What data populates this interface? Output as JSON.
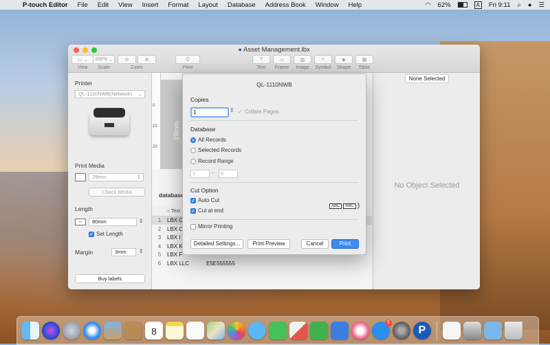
{
  "menubar": {
    "items": [
      "P-touch Editor",
      "File",
      "Edit",
      "View",
      "Insert",
      "Format",
      "Layout",
      "Database",
      "Address Book",
      "Window",
      "Help"
    ],
    "battery": "62%",
    "clock": "Fri 9:11",
    "input_source": "A"
  },
  "window": {
    "title": "Asset Management.lbx",
    "toolbar": {
      "view_label": "View",
      "scale_label": "Scale",
      "scale_value": "200%",
      "zoom_label": "Zoom",
      "print_label": "Print",
      "text_label": "Text",
      "frame_label": "Frame",
      "image_label": "Image",
      "symbol_label": "Symbol",
      "shape_label": "Shape",
      "table_label": "Table"
    },
    "left_panel": {
      "printer_heading": "Printer",
      "printer_select": "QL-1110NWB(Network)",
      "print_media_heading": "Print Media",
      "media_select": "29mm",
      "check_media_button": "Check Media",
      "length_heading": "Length",
      "length_value": "80mm",
      "set_length_label": "Set Length",
      "margin_heading": "Margin",
      "margin_value": "3mm",
      "buy_labels_button": "Buy labels"
    },
    "canvas": {
      "tape_label": "29mm",
      "ruler_marks": [
        "0",
        "10",
        "20"
      ],
      "database_label": "database",
      "column_header": "Text",
      "rows": [
        {
          "num": "1",
          "c1": "LBX C",
          "c2": ""
        },
        {
          "num": "2",
          "c1": "LBX C",
          "c2": ""
        },
        {
          "num": "3",
          "c1": "LBX I",
          "c2": ""
        },
        {
          "num": "4",
          "c1": "LBX K",
          "c2": ""
        },
        {
          "num": "5",
          "c1": "LBX F",
          "c2": ""
        },
        {
          "num": "6",
          "c1": "LBX LLC",
          "c2": "E5E555555"
        }
      ]
    },
    "right_panel": {
      "none_selected": "None Selected",
      "no_object": "No Object Selected"
    }
  },
  "dialog": {
    "title": "QL-1110NWB",
    "copies_heading": "Copies",
    "copies_value": "1",
    "collate_label": "Collate Pages",
    "database_heading": "Database",
    "all_records": "All Records",
    "selected_records": "Selected Records",
    "record_range": "Record Range",
    "range_from": "1",
    "range_dash": "-",
    "range_to": "6",
    "cut_option_heading": "Cut Option",
    "auto_cut": "Auto Cut",
    "cut_at_end": "Cut at end",
    "cut_preview_a": "ABC",
    "cut_preview_b": "ABC",
    "mirror_printing": "Mirror Printing",
    "detailed_settings_button": "Detailed Settings...",
    "print_preview_button": "Print Preview",
    "cancel_button": "Cancel",
    "print_button": "Print"
  },
  "dock": {
    "apps": [
      "finder-icon",
      "siri-icon",
      "launchpad-icon",
      "safari-icon",
      "photo-icon",
      "contacts-icon",
      "calendar-icon",
      "notes-icon",
      "reminders-icon",
      "maps-icon",
      "photos-icon",
      "messages-icon",
      "facetime-icon",
      "news-icon",
      "numbers-icon",
      "keynote-icon",
      "music-icon",
      "app-store-icon",
      "system-preferences-icon",
      "ptouch-icon",
      "textedit-icon",
      "preview-icon",
      "folder-icon",
      "trash-icon"
    ],
    "calendar_day": "8",
    "app_store_badge": "5"
  }
}
